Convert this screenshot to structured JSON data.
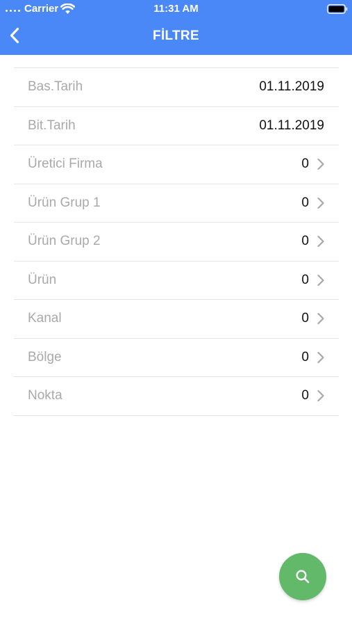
{
  "status_bar": {
    "carrier": "Carrier",
    "time": "11:31 AM",
    "wifi_icon": "wifi-icon",
    "battery_icon": "battery-full-icon"
  },
  "nav": {
    "title": "FİLTRE",
    "back_icon": "chevron-left-icon",
    "background_color": "#4a88f8"
  },
  "filters": {
    "start_date": {
      "label": "Bas.Tarih",
      "value": "01.11.2019"
    },
    "end_date": {
      "label": "Bit.Tarih",
      "value": "01.11.2019"
    },
    "manufacturer": {
      "label": "Üretici Firma",
      "value": "0"
    },
    "product_group_1": {
      "label": "Ürün Grup 1",
      "value": "0"
    },
    "product_group_2": {
      "label": "Ürün Grup 2",
      "value": "0"
    },
    "product": {
      "label": "Ürün",
      "value": "0"
    },
    "channel": {
      "label": "Kanal",
      "value": "0"
    },
    "region": {
      "label": "Bölge",
      "value": "0"
    },
    "point": {
      "label": "Nokta",
      "value": "0"
    }
  },
  "search_button": {
    "icon": "search-icon",
    "color": "#62b96a"
  }
}
